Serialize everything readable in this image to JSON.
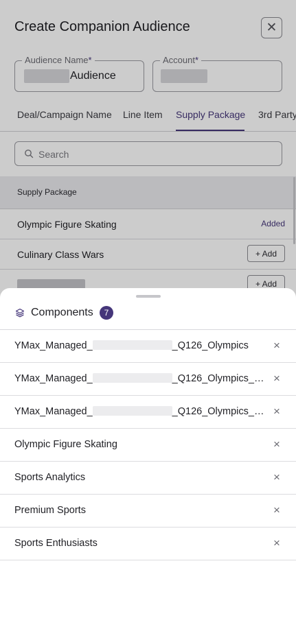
{
  "modal": {
    "title": "Create Companion Audience",
    "close_glyph": "✕"
  },
  "form": {
    "audience_name": {
      "label": "Audience Name",
      "required_mark": "*",
      "value": "Audience"
    },
    "account": {
      "label": "Account",
      "required_mark": "*",
      "value": ""
    }
  },
  "tabs": [
    {
      "label": "Deal/Campaign Name"
    },
    {
      "label": "Line Item"
    },
    {
      "label": "Supply Package"
    },
    {
      "label": "3rd Party"
    }
  ],
  "active_tab": "Supply Package",
  "search": {
    "placeholder": "Search",
    "value": ""
  },
  "table": {
    "header": "Supply Package",
    "rows": [
      {
        "name": "Olympic Figure Skating",
        "status": "Added"
      },
      {
        "name": "Culinary Class Wars",
        "action": "+ Add"
      },
      {
        "name": "",
        "action": "+ Add"
      }
    ]
  },
  "components": {
    "title": "Components",
    "count": "7",
    "remove_glyph": "×",
    "items": [
      {
        "prefix": "YMax_Managed_",
        "suffix": "_Q126_Olympics"
      },
      {
        "prefix": "YMax_Managed_",
        "suffix": "_Q126_Olympics_Ad..."
      },
      {
        "prefix": "YMax_Managed_",
        "suffix": "_Q126_Olympics_Na..."
      },
      {
        "prefix": "Olympic Figure Skating",
        "suffix": ""
      },
      {
        "prefix": "Sports Analytics",
        "suffix": ""
      },
      {
        "prefix": "Premium Sports",
        "suffix": ""
      },
      {
        "prefix": "Sports Enthusiasts",
        "suffix": ""
      }
    ]
  },
  "colors": {
    "accent": "#45367a",
    "overlay": "rgba(0,0,0,0.2)",
    "border": "#d8d8dc"
  },
  "icons": [
    "close-icon",
    "search-icon",
    "layers-icon",
    "remove-icon"
  ]
}
